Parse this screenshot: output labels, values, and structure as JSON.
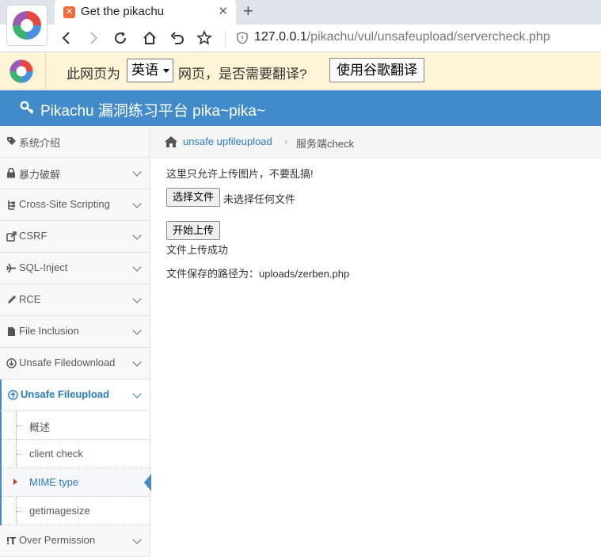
{
  "browser": {
    "tab": {
      "title": "Get the pikachu",
      "favicon": "xampp-icon"
    },
    "address": {
      "host": "127.0.0.1",
      "path": "/pikachu/vul/unsafeupload/servercheck.php"
    }
  },
  "translate_bar": {
    "text_before": "此网页为",
    "language": "英语",
    "text_after": "网页，是否需要翻译?",
    "button": "使用谷歌翻译"
  },
  "app": {
    "title": "Pikachu 漏洞练习平台 pika~pika~",
    "header_color": "#428bca"
  },
  "sidebar": {
    "items": [
      {
        "label": "系统介绍",
        "icon": "tag-icon"
      },
      {
        "label": "暴力破解",
        "icon": "lock-icon"
      },
      {
        "label": "Cross-Site Scripting",
        "icon": "sitemap-icon"
      },
      {
        "label": "CSRF",
        "icon": "share-icon"
      },
      {
        "label": "SQL-Inject",
        "icon": "plane-icon"
      },
      {
        "label": "RCE",
        "icon": "pencil-icon"
      },
      {
        "label": "File Inclusion",
        "icon": "file-icon"
      },
      {
        "label": "Unsafe Filedownload",
        "icon": "download-icon"
      },
      {
        "label": "Unsafe Fileupload",
        "icon": "upload-icon"
      },
      {
        "label": "Over Permission",
        "icon": "exclamation-icon"
      }
    ],
    "submenu": [
      {
        "label": "概述"
      },
      {
        "label": "client check"
      },
      {
        "label": "MIME type"
      },
      {
        "label": "getimagesize"
      }
    ]
  },
  "breadcrumb": {
    "link": "unsafe upfileupload",
    "separator": "›",
    "current": "服务端check"
  },
  "main": {
    "notice": "这里只允许上传图片，不要乱搞!",
    "choose_button": "选择文件",
    "file_status": "未选择任何文件",
    "upload_button": "开始上传",
    "result": "文件上传成功",
    "saved_path": "文件保存的路径为：uploads/zerben.php"
  }
}
